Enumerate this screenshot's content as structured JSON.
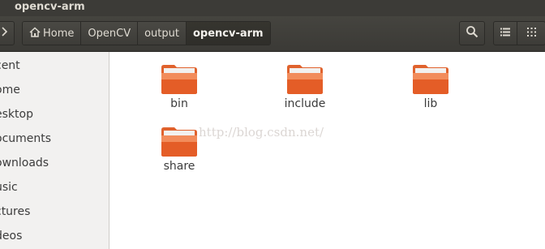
{
  "window": {
    "title": "opencv-arm"
  },
  "toolbar": {
    "back_icon": "chevron-right",
    "breadcrumbs": [
      {
        "label": "Home",
        "icon": "home-icon"
      },
      {
        "label": "OpenCV"
      },
      {
        "label": "output"
      },
      {
        "label": "opencv-arm"
      }
    ],
    "search_icon": "search-icon",
    "view_list_icon": "list-view-icon",
    "view_grid_icon": "grid-view-icon"
  },
  "sidebar": {
    "items": [
      {
        "label": "cent"
      },
      {
        "label": "ome"
      },
      {
        "label": "esktop"
      },
      {
        "label": "ocuments"
      },
      {
        "label": "ownloads"
      },
      {
        "label": "usic"
      },
      {
        "label": "ctures"
      },
      {
        "label": "deos"
      }
    ]
  },
  "files": [
    {
      "name": "bin"
    },
    {
      "name": "include"
    },
    {
      "name": "lib"
    },
    {
      "name": "share"
    }
  ],
  "watermark": "http://blog.csdn.net/",
  "colors": {
    "folder": "#e0622d",
    "folder_light": "#f4a279",
    "title_bar": "#3c3b37"
  }
}
